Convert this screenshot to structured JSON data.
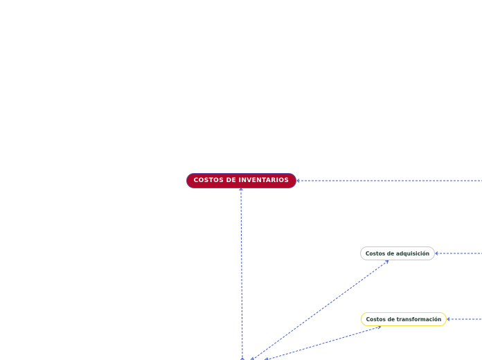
{
  "diagram": {
    "nodes": {
      "root": {
        "label": "COSTOS DE INVENTARIOS"
      },
      "acquisition": {
        "label": "Costos de adquisición"
      },
      "transformation": {
        "label": "Costos de transformación"
      }
    },
    "colors": {
      "root_fill": "#b0082a",
      "root_border": "#5b4fb0",
      "acquisition_border": "#c9c9c9",
      "transformation_border": "#f3dd3a",
      "connector": "#3e5bd6",
      "node_text": "#1f3b2e"
    }
  }
}
